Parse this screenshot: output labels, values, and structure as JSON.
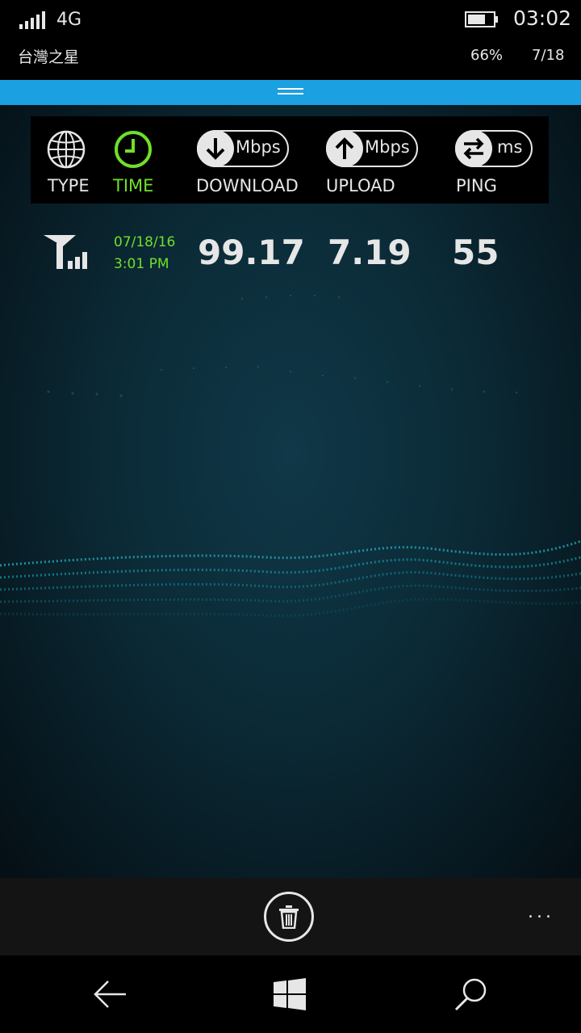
{
  "status": {
    "network": "4G",
    "carrier": "台灣之星",
    "time": "03:02",
    "battery_percent": "66%",
    "date": "7/18"
  },
  "header": {
    "type_label": "TYPE",
    "time_label": "TIME",
    "download_label": "DOWNLOAD",
    "download_unit": "Mbps",
    "upload_label": "UPLOAD",
    "upload_unit": "Mbps",
    "ping_label": "PING",
    "ping_unit": "ms"
  },
  "results": [
    {
      "date": "07/18/16",
      "time": "3:01 PM",
      "download": "99.17",
      "upload": "7.19",
      "ping": "55"
    }
  ],
  "appbar": {
    "more": "..."
  },
  "colors": {
    "accent": "#1ba1e2",
    "highlight": "#6fe02a"
  },
  "icons": [
    "signal-icon",
    "battery-icon",
    "globe-icon",
    "clock-icon",
    "download-arrow-icon",
    "upload-arrow-icon",
    "swap-arrows-icon",
    "cell-tower-icon",
    "trash-icon",
    "back-icon",
    "windows-icon",
    "search-icon"
  ]
}
